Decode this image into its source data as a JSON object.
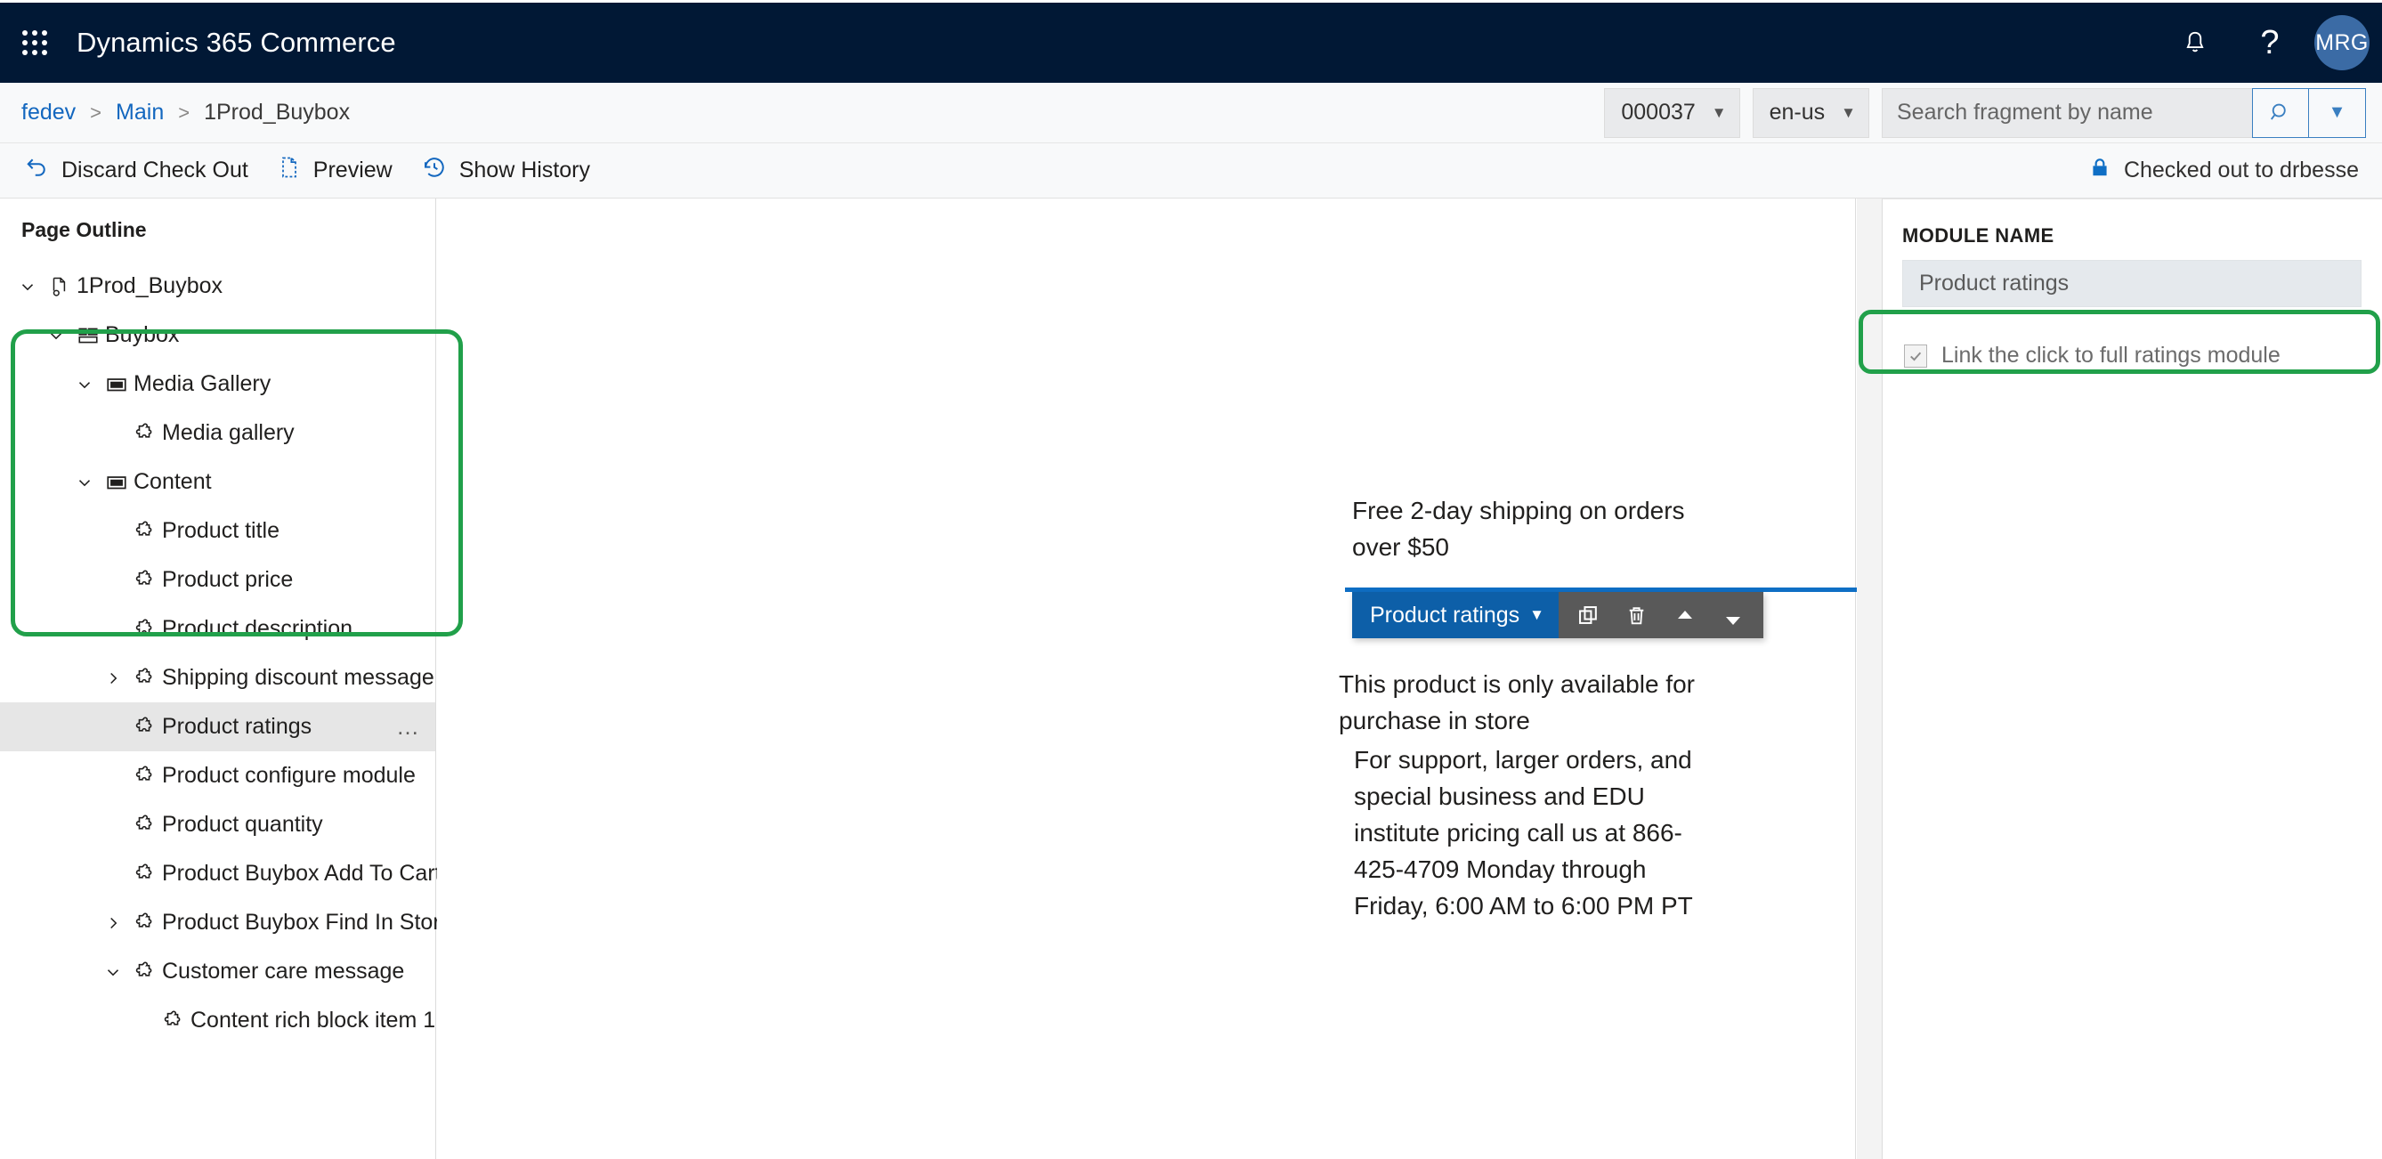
{
  "app_bar": {
    "waffle_icon": "app-launcher-icon",
    "title": "Dynamics 365 Commerce",
    "notification_icon": "bell-icon",
    "help_icon": "question-mark-icon",
    "avatar_initials": "MRG",
    "background_color": "#011835",
    "avatar_color": "#3b6ba5"
  },
  "breadcrumb": {
    "items": [
      {
        "label": "fedev",
        "link": true
      },
      {
        "label": "Main",
        "link": true
      },
      {
        "label": "1Prod_Buybox",
        "link": false
      }
    ],
    "separator": ">"
  },
  "toolbar_right": {
    "channel_select": "000037",
    "locale_select": "en-us",
    "search_placeholder": "Search fragment by name",
    "search_value": "",
    "search_icon": "search-icon",
    "search_dropdown_icon": "chevron-down-icon"
  },
  "command_bar": {
    "commands": [
      {
        "label": "Discard Check Out",
        "icon": "undo-icon"
      },
      {
        "label": "Preview",
        "icon": "page-preview-icon"
      },
      {
        "label": "Show History",
        "icon": "history-clock-icon"
      }
    ],
    "checkout_status": "Checked out to drbesse",
    "checkout_icon": "lock-icon"
  },
  "outline": {
    "title": "Page Outline",
    "tree": [
      {
        "label": "1Prod_Buybox",
        "indent": 0,
        "twisty": "expanded",
        "icon": "page-settings-icon",
        "selected": false
      },
      {
        "label": "Buybox",
        "indent": 1,
        "twisty": "expanded",
        "icon": "layout-grid-icon",
        "selected": false
      },
      {
        "label": "Media Gallery",
        "indent": 2,
        "twisty": "expanded",
        "icon": "slot-rectangle-icon",
        "selected": false
      },
      {
        "label": "Media gallery",
        "indent": 3,
        "twisty": "none",
        "icon": "module-puzzle-icon",
        "selected": false
      },
      {
        "label": "Content",
        "indent": 2,
        "twisty": "expanded",
        "icon": "slot-rectangle-icon",
        "selected": false
      },
      {
        "label": "Product title",
        "indent": 3,
        "twisty": "none",
        "icon": "module-puzzle-icon",
        "selected": false
      },
      {
        "label": "Product price",
        "indent": 3,
        "twisty": "none",
        "icon": "module-puzzle-icon",
        "selected": false
      },
      {
        "label": "Product description",
        "indent": 3,
        "twisty": "none",
        "icon": "module-puzzle-icon",
        "selected": false
      },
      {
        "label": "Shipping discount message",
        "indent": 3,
        "twisty": "collapsed",
        "icon": "module-puzzle-icon",
        "selected": false
      },
      {
        "label": "Product ratings",
        "indent": 3,
        "twisty": "none",
        "icon": "module-puzzle-icon",
        "selected": true,
        "overflow": "…"
      },
      {
        "label": "Product configure module",
        "indent": 3,
        "twisty": "none",
        "icon": "module-puzzle-icon",
        "selected": false
      },
      {
        "label": "Product quantity",
        "indent": 3,
        "twisty": "none",
        "icon": "module-puzzle-icon",
        "selected": false
      },
      {
        "label": "Product Buybox Add To Cart",
        "indent": 3,
        "twisty": "none",
        "icon": "module-puzzle-icon",
        "selected": false
      },
      {
        "label": "Product Buybox Find In Store",
        "indent": 3,
        "twisty": "collapsed",
        "icon": "module-puzzle-icon",
        "selected": false
      },
      {
        "label": "Customer care message",
        "indent": 3,
        "twisty": "expanded",
        "icon": "module-puzzle-icon",
        "selected": false
      },
      {
        "label": "Content rich block item 1",
        "indent": 4,
        "twisty": "none",
        "icon": "module-puzzle-icon",
        "selected": false
      }
    ]
  },
  "canvas": {
    "shipping_message": "Free 2-day shipping on orders over $50",
    "store_message": "This product is only available for purchase in store",
    "support_message": "For support, larger orders, and special business and EDU institute pricing call us at 866-425-4709 Monday through Friday, 6:00 AM to 6:00 PM PT",
    "module_toolbar": {
      "module_label": "Product ratings",
      "caret_icon": "caret-down-icon",
      "copy_icon": "copy-icon",
      "delete_icon": "trash-icon",
      "move_up_icon": "triangle-up-icon",
      "move_down_icon": "triangle-down-icon",
      "accent_color": "#0f6fc5"
    }
  },
  "properties": {
    "section_label": "MODULE NAME",
    "module_name_value": "Product ratings",
    "link_checkbox": {
      "label": "Link the click to full ratings module",
      "checked": true,
      "disabled": true,
      "check_icon": "checkmark-icon"
    }
  },
  "annotations": {
    "color": "#21a04a",
    "boxes": [
      "outline-tree-highlight",
      "link-checkbox-highlight"
    ]
  }
}
